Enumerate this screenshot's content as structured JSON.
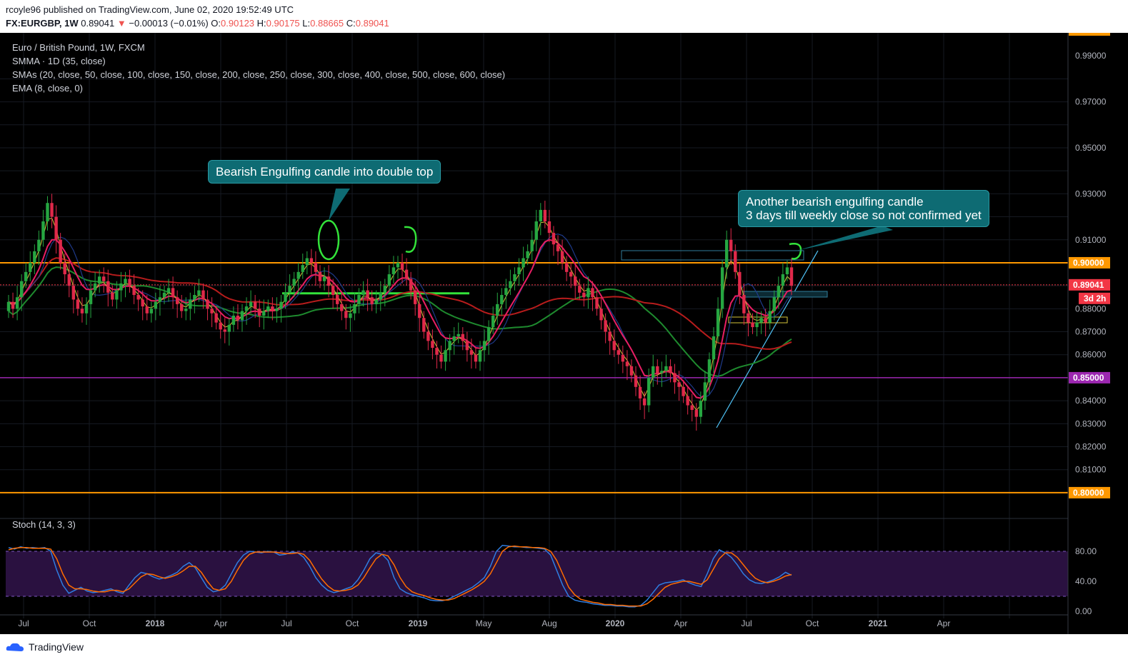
{
  "header": {
    "published": "rcoyle96 published on TradingView.com, June 02, 2020 19:52:49 UTC",
    "symbol": "FX:EURGBP, 1W",
    "price": "0.89041",
    "change_arrow": "▼",
    "change": "−0.00013 (−0.01%)",
    "o_label": "O:",
    "o": "0.90123",
    "h_label": "H:",
    "h": "0.90175",
    "l_label": "L:",
    "l": "0.88665",
    "c_label": "C:",
    "c": "0.89041"
  },
  "legend": {
    "instrument": "Euro / British Pound, 1W, FXCM",
    "smma": "SMMA · 1D (35, close)",
    "smas": "SMAs (20, close, 50, close, 100, close, 150, close, 200, close, 250, close, 300, close, 400, close, 500, close, 600, close)",
    "ema": "EMA (8, close, 0)",
    "stoch": "Stoch (14, 3, 3)"
  },
  "callouts": {
    "left": "Bearish Engulfing candle into double top",
    "right_line1": "Another bearish engulfing candle",
    "right_line2": "3 days till weekly close so not confirmed yet"
  },
  "price_badges": {
    "p090": "0.90000",
    "last": "0.89041",
    "countdown": "3d 2h",
    "p085": "0.85000",
    "p080": "0.80000"
  },
  "footer": {
    "brand": "TradingView"
  },
  "colors": {
    "orange": "#ff9800",
    "purple": "#9c27b0",
    "red_badge": "#f23645",
    "bull": "#26a641",
    "bear": "#e0294a",
    "callout": "#0e6b73",
    "stoch_k": "#2f7de1",
    "stoch_d": "#ff6d00"
  },
  "chart_data": {
    "type": "candlestick",
    "x_tick_labels": [
      "Jul",
      "Oct",
      "2018",
      "Apr",
      "Jul",
      "Oct",
      "2019",
      "May",
      "Aug",
      "2020",
      "Apr",
      "Jul",
      "Oct",
      "2021",
      "Apr"
    ],
    "y_tick_labels": [
      "0.99000",
      "0.97000",
      "0.95000",
      "0.93000",
      "0.91000",
      "0.88000",
      "0.87000",
      "0.86000",
      "0.84000",
      "0.83000",
      "0.82000",
      "0.81000"
    ],
    "ylim": [
      0.795,
      1.0
    ],
    "horizontal_levels": [
      0.9,
      0.85,
      0.8
    ],
    "close_series": [
      0.883,
      0.88,
      0.885,
      0.892,
      0.896,
      0.9,
      0.905,
      0.91,
      0.918,
      0.926,
      0.92,
      0.91,
      0.9,
      0.895,
      0.89,
      0.884,
      0.88,
      0.878,
      0.882,
      0.888,
      0.891,
      0.894,
      0.892,
      0.887,
      0.884,
      0.888,
      0.891,
      0.893,
      0.89,
      0.886,
      0.884,
      0.881,
      0.878,
      0.88,
      0.883,
      0.885,
      0.887,
      0.889,
      0.885,
      0.882,
      0.879,
      0.88,
      0.884,
      0.886,
      0.888,
      0.884,
      0.88,
      0.878,
      0.874,
      0.871,
      0.87,
      0.873,
      0.877,
      0.875,
      0.879,
      0.881,
      0.883,
      0.88,
      0.877,
      0.879,
      0.881,
      0.879,
      0.88,
      0.883,
      0.887,
      0.89,
      0.893,
      0.896,
      0.899,
      0.902,
      0.9,
      0.896,
      0.892,
      0.894,
      0.89,
      0.886,
      0.882,
      0.879,
      0.876,
      0.878,
      0.882,
      0.886,
      0.888,
      0.885,
      0.882,
      0.884,
      0.887,
      0.89,
      0.895,
      0.898,
      0.9,
      0.897,
      0.893,
      0.888,
      0.882,
      0.876,
      0.87,
      0.866,
      0.863,
      0.86,
      0.857,
      0.862,
      0.866,
      0.868,
      0.869,
      0.866,
      0.862,
      0.86,
      0.857,
      0.862,
      0.866,
      0.872,
      0.877,
      0.882,
      0.886,
      0.889,
      0.892,
      0.895,
      0.898,
      0.902,
      0.905,
      0.91,
      0.918,
      0.923,
      0.918,
      0.913,
      0.908,
      0.905,
      0.9,
      0.896,
      0.894,
      0.89,
      0.887,
      0.885,
      0.889,
      0.885,
      0.88,
      0.875,
      0.87,
      0.866,
      0.862,
      0.86,
      0.857,
      0.855,
      0.851,
      0.846,
      0.841,
      0.838,
      0.85,
      0.855,
      0.852,
      0.853,
      0.855,
      0.852,
      0.848,
      0.846,
      0.842,
      0.838,
      0.836,
      0.833,
      0.84,
      0.848,
      0.858,
      0.868,
      0.88,
      0.898,
      0.91,
      0.905,
      0.896,
      0.886,
      0.878,
      0.874,
      0.872,
      0.874,
      0.876,
      0.874,
      0.879,
      0.885,
      0.89,
      0.895,
      0.898,
      0.89
    ],
    "stoch_k": [
      85,
      83,
      86,
      84,
      85,
      84,
      85,
      80,
      55,
      35,
      24,
      28,
      32,
      27,
      25,
      26,
      28,
      30,
      26,
      24,
      35,
      45,
      52,
      50,
      46,
      43,
      45,
      48,
      52,
      60,
      65,
      58,
      45,
      32,
      26,
      28,
      35,
      50,
      65,
      75,
      80,
      79,
      78,
      80,
      79,
      75,
      76,
      79,
      78,
      72,
      60,
      45,
      35,
      28,
      25,
      27,
      30,
      33,
      42,
      55,
      70,
      78,
      76,
      68,
      45,
      30,
      25,
      22,
      20,
      18,
      15,
      14,
      14,
      16,
      20,
      24,
      28,
      32,
      38,
      45,
      60,
      80,
      88,
      87,
      86,
      86,
      85,
      85,
      84,
      83,
      75,
      55,
      35,
      20,
      15,
      13,
      12,
      10,
      9,
      8,
      8,
      7,
      7,
      6,
      6,
      8,
      15,
      25,
      35,
      38,
      39,
      40,
      42,
      38,
      35,
      33,
      50,
      70,
      82,
      78,
      72,
      62,
      50,
      42,
      38,
      37,
      39,
      42,
      46,
      52,
      48
    ],
    "stoch_d": [
      82,
      84,
      85,
      85,
      84,
      84,
      84,
      83,
      70,
      50,
      35,
      30,
      30,
      29,
      27,
      26,
      26,
      28,
      28,
      26,
      30,
      38,
      46,
      50,
      49,
      46,
      44,
      46,
      49,
      54,
      60,
      60,
      52,
      40,
      30,
      28,
      30,
      40,
      55,
      68,
      76,
      79,
      79,
      79,
      79,
      78,
      77,
      77,
      78,
      76,
      68,
      55,
      43,
      34,
      28,
      27,
      28,
      30,
      35,
      45,
      58,
      70,
      76,
      74,
      62,
      45,
      33,
      26,
      23,
      21,
      18,
      16,
      15,
      15,
      17,
      21,
      25,
      29,
      34,
      40,
      50,
      65,
      80,
      86,
      87,
      86,
      86,
      85,
      85,
      84,
      80,
      68,
      50,
      32,
      22,
      16,
      14,
      12,
      11,
      9,
      9,
      8,
      8,
      7,
      7,
      7,
      10,
      16,
      24,
      32,
      36,
      38,
      40,
      40,
      38,
      36,
      42,
      56,
      70,
      78,
      78,
      72,
      62,
      52,
      44,
      40,
      38,
      40,
      43,
      47,
      49
    ]
  }
}
